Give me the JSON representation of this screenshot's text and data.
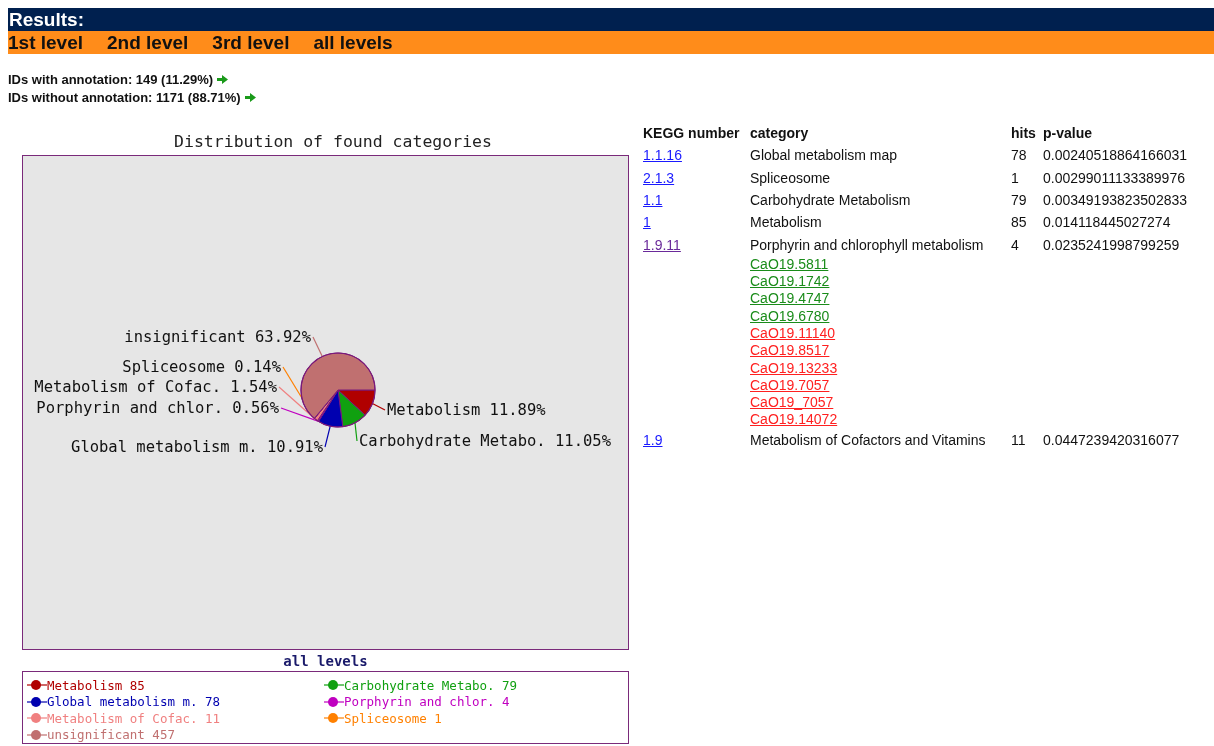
{
  "header": {
    "title": "Results:"
  },
  "levels": [
    "1st level",
    "2nd level",
    "3rd level",
    "all levels"
  ],
  "annotation": [
    "IDs with annotation: 149 (11.29%)",
    "IDs without annotation: 1171 (88.71%)"
  ],
  "chart": {
    "chart_data": {
      "type": "pie",
      "title": "Distribution of found categories",
      "value_labels": [
        "11.89%",
        "11.05%",
        "10.91%",
        "0.56%",
        "1.54%",
        "0.14%",
        "63.92%"
      ],
      "categories": [
        "Metabolism",
        "Carbohydrate Metabo.",
        "Global metabolism m.",
        "Porphyrin and chlor.",
        "Metabolism of Cofac.",
        "Spliceosome",
        "insignificant"
      ],
      "values": [
        11.89,
        11.05,
        10.91,
        0.56,
        1.54,
        0.14,
        63.92
      ]
    }
  },
  "legend": {
    "title": "all levels",
    "items": [
      {
        "label": "Metabolism 85",
        "color": "#b00000"
      },
      {
        "label": "Carbohydrate Metabo. 79",
        "color": "#10a010"
      },
      {
        "label": "Global metabolism m. 78",
        "color": "#0000b0"
      },
      {
        "label": "Porphyrin and chlor. 4",
        "color": "#c000c0"
      },
      {
        "label": "Metabolism of Cofac. 11",
        "color": "#f08080"
      },
      {
        "label": "Spliceosome 1",
        "color": "#ff8000"
      },
      {
        "label": "unsignificant 457",
        "color": "#c07070"
      }
    ]
  },
  "table": {
    "columns": [
      "KEGG number",
      "category",
      "hits",
      "p-value"
    ],
    "rows": [
      {
        "kegg": "1.1.16",
        "category": "Global metabolism map",
        "hits": "78",
        "p_value": "0.00240518864166031",
        "visited": false
      },
      {
        "kegg": "2.1.3",
        "category": "Spliceosome",
        "hits": "1",
        "p_value": "0.00299011133389976",
        "visited": false
      },
      {
        "kegg": "1.1",
        "category": "Carbohydrate Metabolism",
        "hits": "79",
        "p_value": "0.00349193823502833",
        "visited": false
      },
      {
        "kegg": "1",
        "category": "Metabolism",
        "hits": "85",
        "p_value": "0.014118445027274",
        "visited": false
      },
      {
        "kegg": "1.9.11",
        "category": "Porphyrin and chlorophyll metabolism",
        "hits": "4",
        "p_value": "0.0235241998799259",
        "visited": true,
        "genes": [
          {
            "id": "CaO19.5811",
            "color": "#1a8c1a"
          },
          {
            "id": "CaO19.1742",
            "color": "#1a8c1a"
          },
          {
            "id": "CaO19.4747",
            "color": "#1a8c1a"
          },
          {
            "id": "CaO19.6780",
            "color": "#1a8c1a"
          },
          {
            "id": "CaO19.11140",
            "color": "#ff2020"
          },
          {
            "id": "CaO19.8517",
            "color": "#ff2020"
          },
          {
            "id": "CaO19.13233",
            "color": "#ff2020"
          },
          {
            "id": "CaO19.7057",
            "color": "#ff2020"
          },
          {
            "id": "CaO19_7057",
            "color": "#ff2020"
          },
          {
            "id": "CaO19.14072",
            "color": "#ff2020"
          }
        ]
      },
      {
        "kegg": "1.9",
        "category": "Metabolism of Cofactors and Vitamins",
        "hits": "11",
        "p_value": "0.0447239420316077",
        "visited": false
      }
    ]
  }
}
